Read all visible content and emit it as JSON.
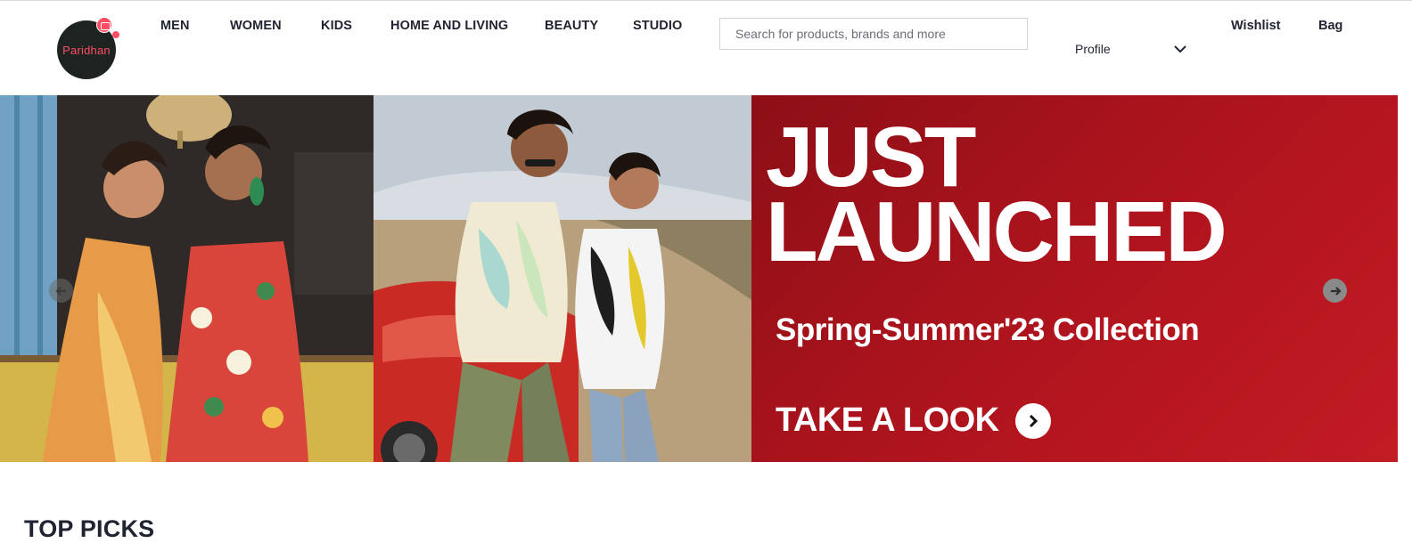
{
  "brand": {
    "logo_text": "Paridhan",
    "logo_color": "#1d2321",
    "accent_color": "#ff4e63",
    "logo_icon": "shopping-bag-icon"
  },
  "nav": {
    "items": [
      {
        "label": "MEN"
      },
      {
        "label": "WOMEN"
      },
      {
        "label": "KIDS"
      },
      {
        "label": "HOME AND LIVING"
      },
      {
        "label": "BEAUTY"
      },
      {
        "label": "STUDIO"
      }
    ]
  },
  "search": {
    "placeholder": "Search for products, brands and more",
    "value": ""
  },
  "account": {
    "profile_label": "Profile",
    "profile_icon": "chevron-down-icon",
    "wishlist_label": "Wishlist",
    "bag_label": "Bag"
  },
  "banner": {
    "promo_title_line1": "JUST",
    "promo_title_line2": "LAUNCHED",
    "promo_subtitle": "Spring-Summer'23 Collection",
    "cta_label": "TAKE A LOOK",
    "cta_icon": "chevron-right-icon",
    "prev_icon": "arrow-left-icon",
    "next_icon": "arrow-right-icon",
    "promo_color": "#b8161f"
  },
  "sections": {
    "top_picks_title": "TOP PICKS"
  }
}
